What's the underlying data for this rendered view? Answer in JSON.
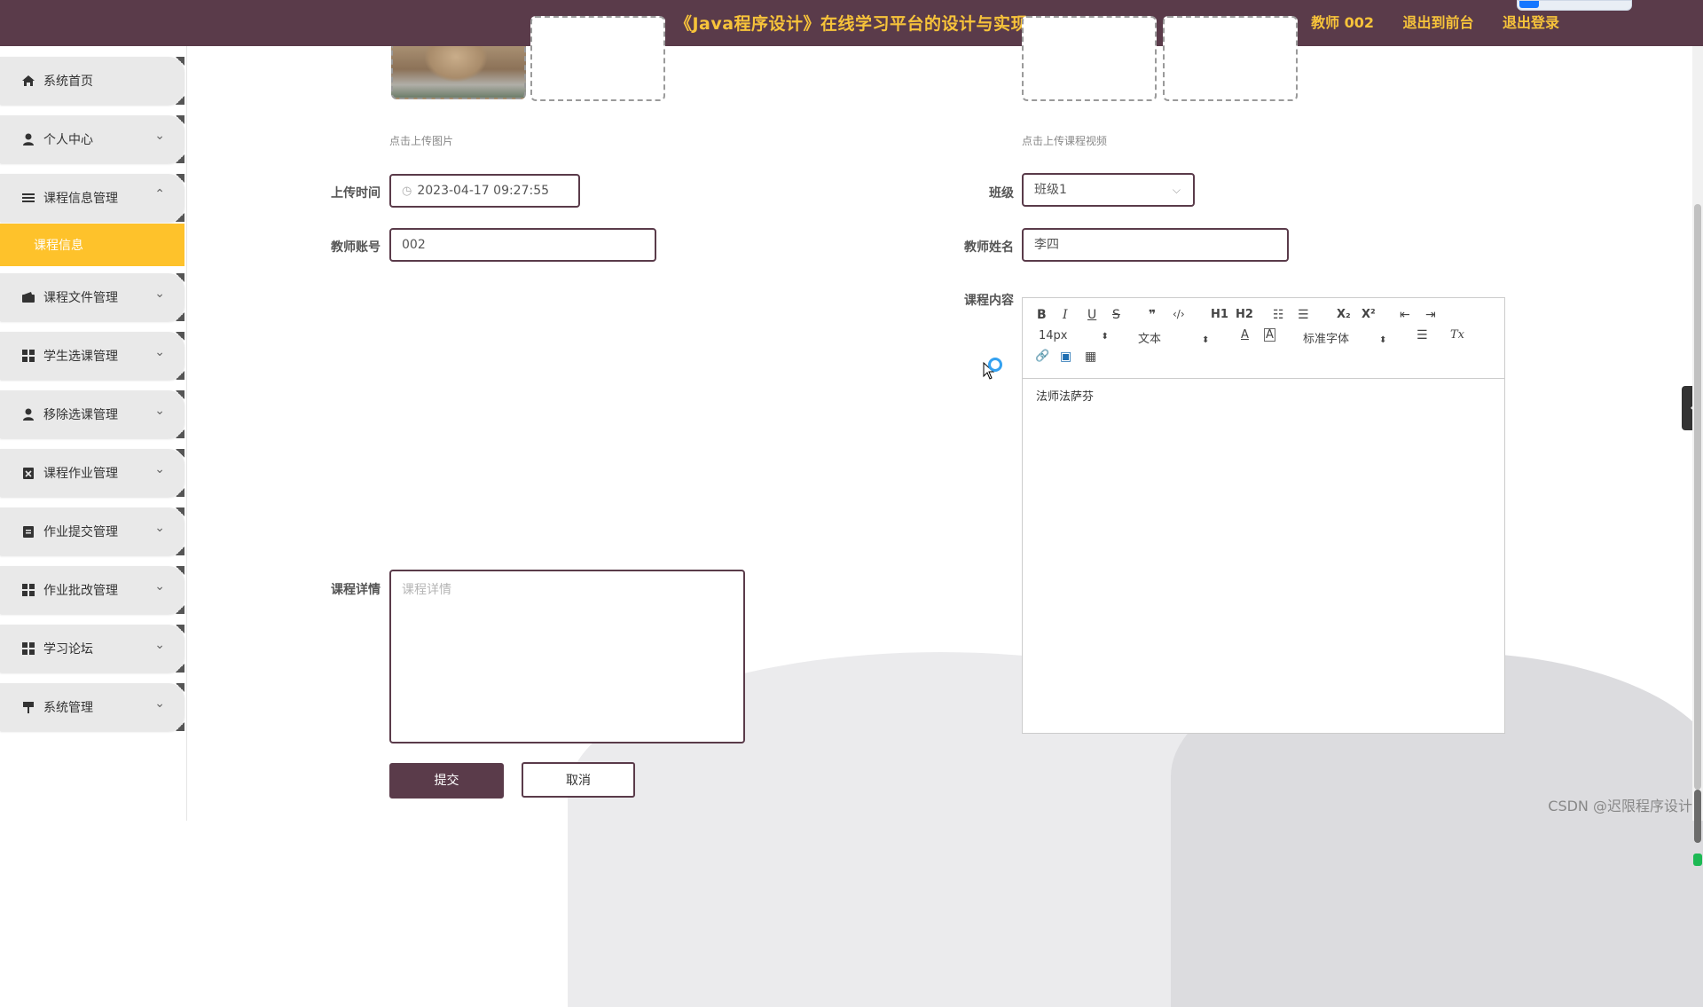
{
  "header": {
    "title": "《Java程序设计》在线学习平台的设计与实现",
    "links": [
      "教师 002",
      "退出到前台",
      "退出登录"
    ]
  },
  "sidebar": {
    "items": [
      {
        "label": "系统首页",
        "icon": "home-icon",
        "chevron": false
      },
      {
        "label": "个人中心",
        "icon": "user-icon",
        "chevron": true
      },
      {
        "label": "课程信息管理",
        "icon": "list-icon",
        "chevron": true,
        "expanded": true
      },
      {
        "label": "课程信息",
        "sub": true
      },
      {
        "label": "课程文件管理",
        "icon": "wallet-icon",
        "chevron": true
      },
      {
        "label": "学生选课管理",
        "icon": "grid-icon",
        "chevron": true
      },
      {
        "label": "移除选课管理",
        "icon": "user-icon",
        "chevron": true
      },
      {
        "label": "课程作业管理",
        "icon": "clipboard-x-icon",
        "chevron": true
      },
      {
        "label": "作业提交管理",
        "icon": "clipboard-icon",
        "chevron": true
      },
      {
        "label": "作业批改管理",
        "icon": "grid-icon",
        "chevron": true
      },
      {
        "label": "学习论坛",
        "icon": "grid-icon",
        "chevron": true
      },
      {
        "label": "系统管理",
        "icon": "pin-icon",
        "chevron": true
      }
    ]
  },
  "form": {
    "upload_image_hint": "点击上传图片",
    "upload_video_hint": "点击上传课程视频",
    "upload_time_label": "上传时间",
    "upload_time_value": "2023-04-17 09:27:55",
    "class_label": "班级",
    "class_value": "班级1",
    "teacher_account_label": "教师账号",
    "teacher_account_value": "002",
    "teacher_name_label": "教师姓名",
    "teacher_name_value": "李四",
    "course_content_label": "课程内容",
    "course_detail_label": "课程详情",
    "course_detail_placeholder": "课程详情",
    "submit_label": "提交",
    "cancel_label": "取消"
  },
  "editor": {
    "font_size": "14px",
    "text_type": "文本",
    "font_family": "标准字体",
    "content": "法师法萨芬",
    "toolbar": {
      "bold": "B",
      "italic": "I",
      "underline": "U",
      "strike": "S",
      "quote": "❞",
      "code": "‹/›",
      "h1": "H1",
      "h2": "H2",
      "ol": "☷",
      "ul": "☰",
      "sub": "X₂",
      "sup": "X²",
      "outdent": "⇤",
      "indent": "⇥",
      "color": "A",
      "bg": "A",
      "align": "☰",
      "clear": "Tx",
      "link": "🔗",
      "image": "▣",
      "video": "▦"
    }
  },
  "watermark": "CSDN @迟限程序设计",
  "colors": {
    "header_bg": "#5a3b4a",
    "accent": "#f7c33a",
    "active_menu": "#fec22b"
  }
}
